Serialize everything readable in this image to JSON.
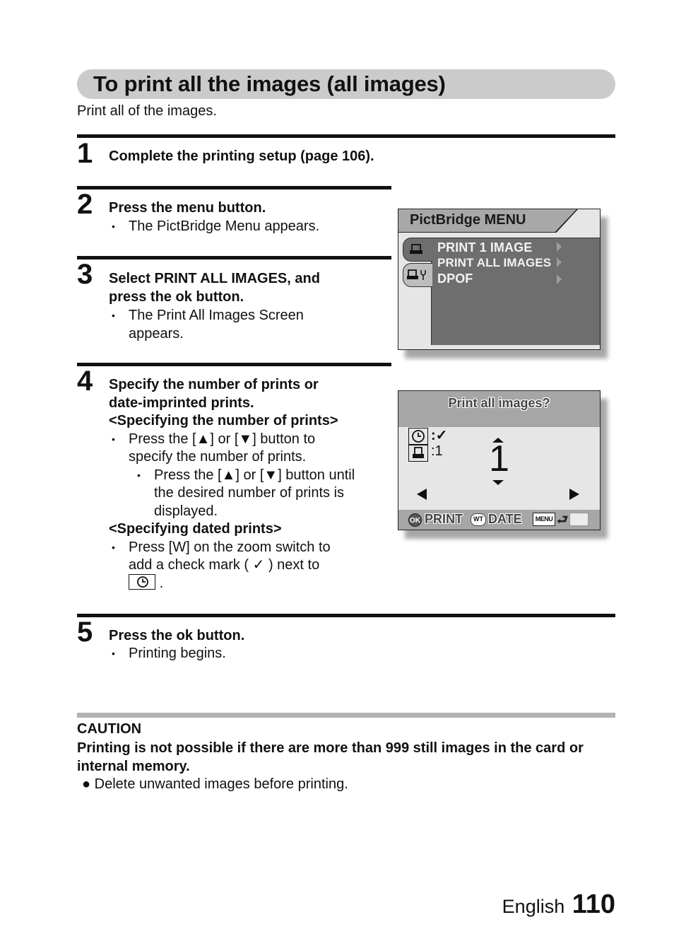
{
  "title": "To print all the images (all images)",
  "intro": "Print all of the images.",
  "steps": [
    {
      "number": "1",
      "heading": "Complete the printing setup (page 106)."
    },
    {
      "number": "2",
      "heading": "Press the menu button.",
      "bullets": [
        "The PictBridge Menu appears."
      ]
    },
    {
      "number": "3",
      "heading_lines": [
        "Select PRINT ALL IMAGES, and",
        "press the ok button."
      ],
      "bullets": [
        "The Print All Images Screen appears."
      ]
    },
    {
      "number": "4",
      "heading_lines": [
        "Specify the number of prints or",
        "date-imprinted prints."
      ],
      "subsection_1": "<Specifying the number of prints>",
      "bullet_1": "Press the [▲] or [▼] button to specify the number of prints.",
      "sub_bullet_1": "Press the [▲] or [▼] button until the desired number of prints is displayed.",
      "subsection_2": "<Specifying dated prints>",
      "bullet_2_text": "Press [W] on the zoom switch to add a check mark (",
      "bullet_2_check": "✓",
      "bullet_2_tail": " ) next to",
      "bullet_2_end": "."
    },
    {
      "number": "5",
      "heading": "Press the ok button.",
      "bullets": [
        "Printing begins."
      ]
    }
  ],
  "pictbridge_menu": {
    "title": "PictBridge MENU",
    "tabs": [
      {
        "icon": "printer-icon",
        "active": true
      },
      {
        "icon": "printer-settings-icon",
        "active": false
      }
    ],
    "items": [
      "PRINT 1 IMAGE",
      "PRINT ALL IMAGES",
      "DPOF"
    ]
  },
  "print_all_screen": {
    "title": "Print all images?",
    "date_setting": "✓",
    "date_prefix": ":",
    "copies_label": ":1",
    "copies_value": "1",
    "footer": {
      "ok_badge": "OK",
      "ok_label": "PRINT",
      "wt_badge": "WT",
      "wt_label": "DATE",
      "menu_badge": "MENU",
      "return_glyph": "⮐"
    }
  },
  "caution": {
    "label": "CAUTION",
    "text": "Printing is not possible if there are more than 999 still images in the card or internal memory.",
    "bullet": "● Delete unwanted images before printing."
  },
  "footer": {
    "language": "English",
    "page_number": "110"
  }
}
